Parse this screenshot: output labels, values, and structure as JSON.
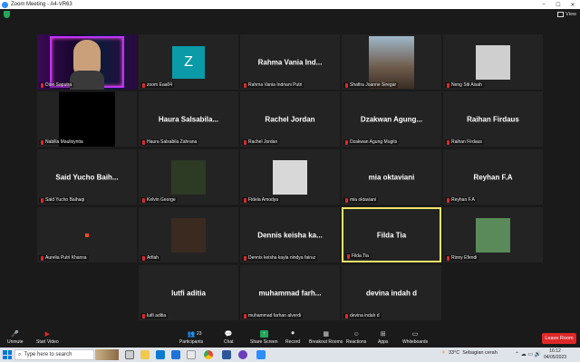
{
  "window": {
    "title": "Zoom Meeting - A4-VR63",
    "view_label": "View"
  },
  "participants": [
    {
      "name": "Dion Saputra",
      "display": "",
      "video": "person"
    },
    {
      "name": "zoom Eaa04",
      "display": "",
      "video": "avatar",
      "avatar_letter": "Z",
      "avatar_color": "#0b9aa8"
    },
    {
      "name": "Rahma Vania Indriani Putri",
      "display": "Rahma Vania Ind...",
      "video": "none"
    },
    {
      "name": "Shafira Joanne Siregar",
      "display": "",
      "video": "photo"
    },
    {
      "name": "Neng Siti Aisah",
      "display": "",
      "video": "photo-small"
    },
    {
      "name": "Nabilla Maulisyntia",
      "display": "",
      "video": "black"
    },
    {
      "name": "Haura Salsabila Zahrana",
      "display": "Haura Salsabila...",
      "video": "none"
    },
    {
      "name": "Rachel Jordan",
      "display": "Rachel Jordan",
      "video": "none"
    },
    {
      "name": "Dzakwan Agung Mugits",
      "display": "Dzakwan Agung...",
      "video": "none"
    },
    {
      "name": "Raihan Firdaus",
      "display": "Raihan Firdaus",
      "video": "none"
    },
    {
      "name": "Said Yucho Baihaqi",
      "display": "Said Yucho Baih...",
      "video": "none"
    },
    {
      "name": "Kelvin George",
      "display": "",
      "video": "photo-small"
    },
    {
      "name": "Fidela Amodya",
      "display": "",
      "video": "photo-small"
    },
    {
      "name": "mia oktaviani",
      "display": "mia oktaviani",
      "video": "none"
    },
    {
      "name": "Reyhan F.A",
      "display": "Reyhan F.A",
      "video": "none"
    },
    {
      "name": "Aurelia Putri Khansa",
      "display": "",
      "video": "dot"
    },
    {
      "name": "Arfiah",
      "display": "",
      "video": "photo-small"
    },
    {
      "name": "Dennis keisha kayla nindya fairuz",
      "display": "Dennis keisha ka...",
      "video": "none"
    },
    {
      "name": "Filda Tia",
      "display": "Filda Tia",
      "video": "none",
      "active": true
    },
    {
      "name": "Rinny Efendi",
      "display": "",
      "video": "photo-small"
    },
    {
      "name": "lutfi aditia",
      "display": "lutfi aditia",
      "video": "none"
    },
    {
      "name": "muhammad farhan alverdi",
      "display": "muhammad farh...",
      "video": "none"
    },
    {
      "name": "devina indah d",
      "display": "devina indah d",
      "video": "none"
    }
  ],
  "toolbar": {
    "unmute": "Unmute",
    "start_video": "Start Video",
    "participants": "Participants",
    "participants_count": "23",
    "chat": "Chat",
    "share_screen": "Share Screen",
    "record": "Record",
    "breakout": "Breakout Rooms",
    "reactions": "Reactions",
    "apps": "Apps",
    "whiteboards": "Whiteboards",
    "leave": "Leave Room"
  },
  "taskbar": {
    "search_placeholder": "Type here to search",
    "weather_temp": "33°C",
    "weather_text": "Sebagian cerah",
    "time": "16:12",
    "date": "04/05/2023"
  },
  "colors": {
    "accent_green": "#23a55a",
    "leave_red": "#e02828",
    "active_yellow": "#f6e36a"
  }
}
